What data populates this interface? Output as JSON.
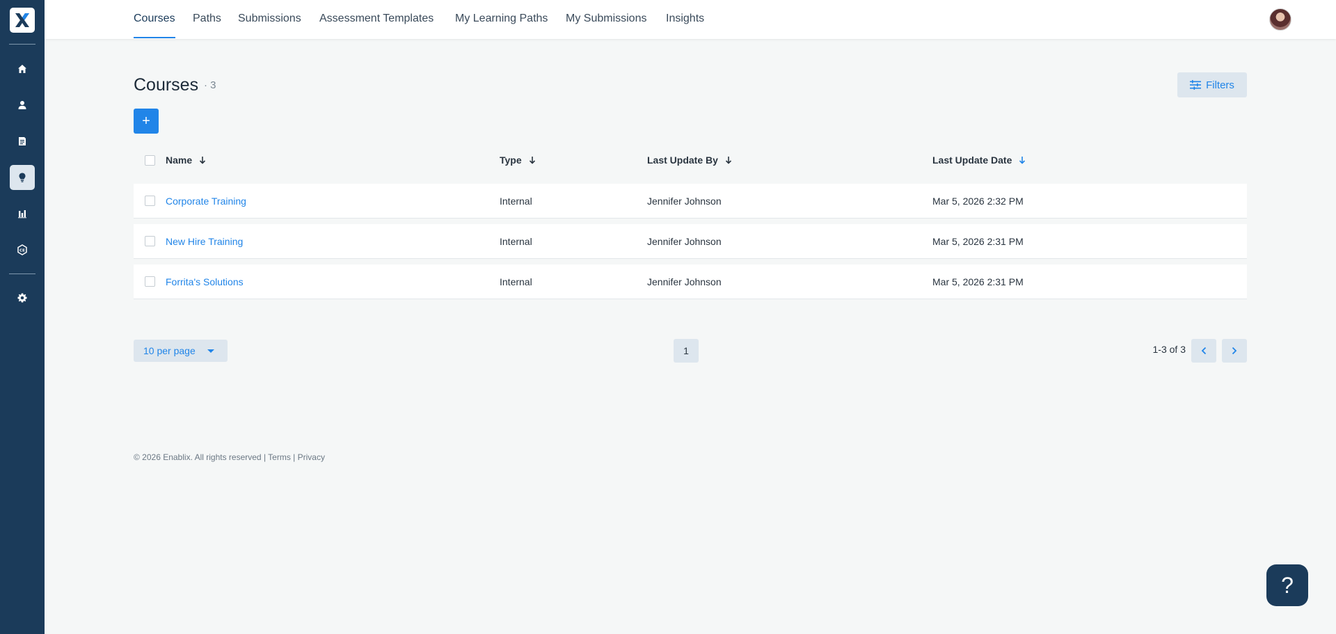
{
  "colors": {
    "sidebar": "#1b3b5a",
    "accent": "#2185e8",
    "chip_bg": "#dde6ee"
  },
  "sidebar": {
    "logo_icon": "enablix-x-logo",
    "items": [
      {
        "icon": "home-icon"
      },
      {
        "icon": "person-icon"
      },
      {
        "icon": "document-icon"
      },
      {
        "icon": "lightbulb-icon",
        "active": true
      },
      {
        "icon": "bar-chart-icon"
      },
      {
        "icon": "ce-badge-icon"
      },
      {
        "icon": "gear-icon"
      }
    ]
  },
  "nav": {
    "tabs": [
      "Courses",
      "Paths",
      "Submissions",
      "Assessment Templates",
      "My Learning Paths",
      "My Submissions",
      "Insights"
    ],
    "active": "Courses"
  },
  "page": {
    "title": "Courses",
    "count": "· 3",
    "filters_label": "Filters",
    "add_label": "+"
  },
  "table": {
    "columns": [
      "Name",
      "Type",
      "Last Update By",
      "Last Update Date"
    ],
    "rows": [
      {
        "name": "Corporate Training",
        "type": "Internal",
        "updated_by": "Jennifer Johnson",
        "updated_date": "Mar 5, 2026 2:32 PM"
      },
      {
        "name": "New Hire Training",
        "type": "Internal",
        "updated_by": "Jennifer Johnson",
        "updated_date": "Mar 5, 2026 2:31 PM"
      },
      {
        "name": "Forrita's Solutions",
        "type": "Internal",
        "updated_by": "Jennifer Johnson",
        "updated_date": "Mar 5, 2026 2:31 PM"
      }
    ]
  },
  "pagination": {
    "per_page": "10 per page",
    "current_page": "1",
    "range": "1-3 of 3"
  },
  "footer": {
    "copyright": "© 2026 Enablix. All rights reserved | ",
    "terms": "Terms",
    "sep": " | ",
    "privacy": "Privacy"
  },
  "help_label": "?"
}
